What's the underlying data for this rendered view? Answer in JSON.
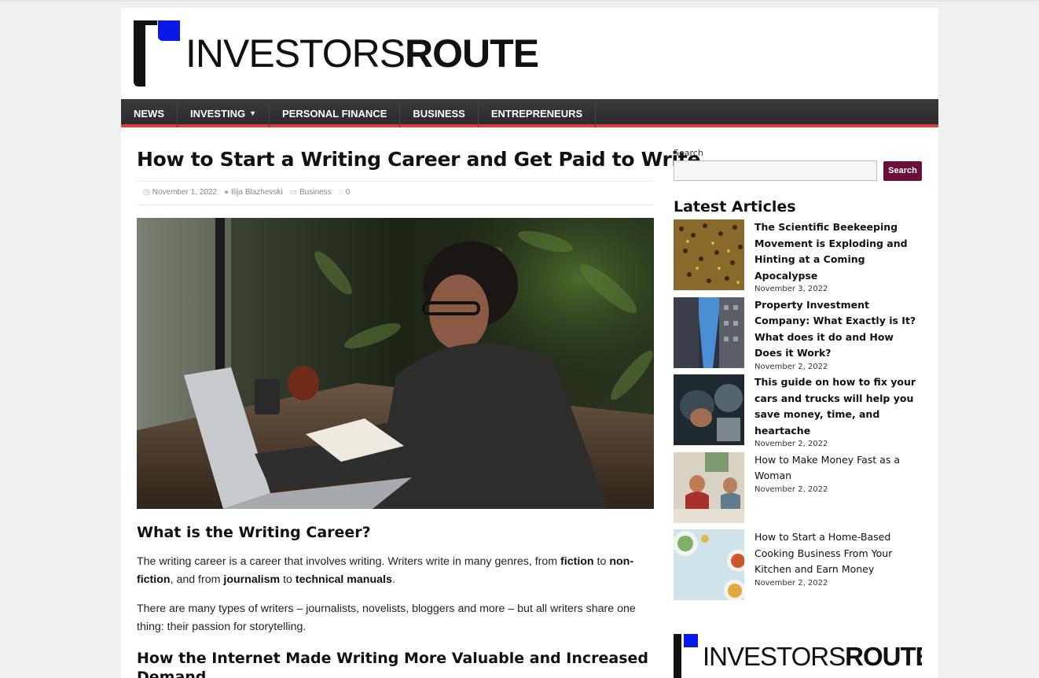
{
  "site": {
    "logo_thin": "INVESTORS",
    "logo_bold": "ROUTE",
    "accent_color": "#d9413a",
    "logo_flag_color": "#0a18e8"
  },
  "nav": {
    "items": [
      "NEWS",
      "INVESTING",
      "PERSONAL FINANCE",
      "BUSINESS",
      "ENTREPRENEURS"
    ]
  },
  "article": {
    "title": "How to Start a Writing Career and Get Paid to Write",
    "date": "November 1, 2022",
    "author": "Ilija Blazhevski",
    "category": "Business",
    "comments": "0",
    "h2_1": "What is the Writing Career?",
    "p1_a": "The writing career is a career that involves writing. Writers write in many genres, from ",
    "p1_b": "fiction",
    "p1_c": " to ",
    "p1_d": "non-fiction",
    "p1_e": ", and from ",
    "p1_f": "journalism",
    "p1_g": " to ",
    "p1_h": "technical manuals",
    "p1_i": ".",
    "p2": "There are many types of writers – journalists, novelists, bloggers and more – but all writers share one thing: their passion for storytelling.",
    "h2_2": "How the Internet Made Writing More Valuable and Increased Demand"
  },
  "sidebar": {
    "search_label": "Search",
    "search_button": "Search",
    "latest_title": "Latest Articles",
    "latest": [
      {
        "title": "The Scientific Beekeeping Movement is Exploding and Hinting at a Coming Apocalypse",
        "date": "November 3, 2022",
        "bold": true
      },
      {
        "title": "Property Investment Company: What Exactly is It? What does it do and How Does it Work?",
        "date": "November 2, 2022",
        "bold": true
      },
      {
        "title": "This guide on how to fix your cars and trucks will help you save money, time, and heartache",
        "date": "November 2, 2022",
        "bold": true
      },
      {
        "title": "How to Make Money Fast as a Woman",
        "date": "November 2, 2022",
        "bold": false
      },
      {
        "title": "How to Start a Home-Based Cooking Business From Your Kitchen and Earn Money",
        "date": "November 2, 2022",
        "bold": false
      }
    ],
    "button_color": "#6a0f3a"
  }
}
